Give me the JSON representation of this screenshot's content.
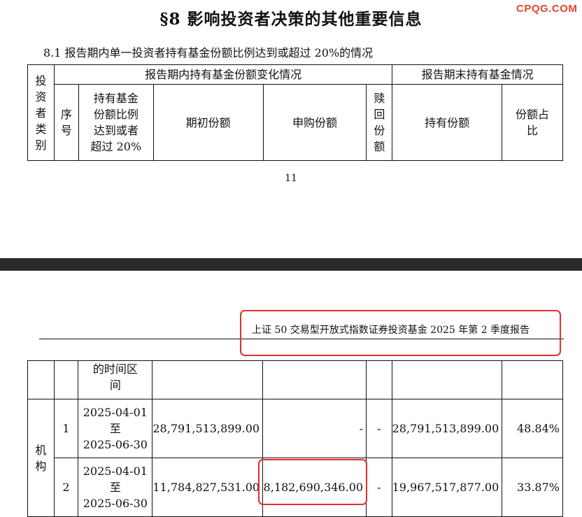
{
  "watermark": "CPQG.COM",
  "section_title": "§8  影响投资者决策的其他重要信息",
  "subsection": "8.1  报告期内单一投资者持有基金份额比例达到或超过 20%的情况",
  "table_header": {
    "investor_type": [
      "投",
      "资",
      "者",
      "类",
      "别"
    ],
    "period_change": "报告期内持有基金份额变化情况",
    "period_end": "报告期末持有基金情况",
    "seq": [
      "序",
      "号"
    ],
    "holding_range": [
      "持有基金",
      "份额比例",
      "达到或者",
      "超过 20%"
    ],
    "initial_shares": "期初份额",
    "subscribed_shares": "申购份额",
    "redeemed_shares": [
      "赎",
      "回",
      "份",
      "额"
    ],
    "held_shares": "持有份额",
    "share_ratio": [
      "份额占",
      "比"
    ]
  },
  "page_number": "11",
  "report_name": "上证 50 交易型开放式指数证券投资基金 2025 年第 2 季度报告",
  "continued_header": [
    "的时间区",
    "间"
  ],
  "investor_category": [
    "机",
    "构"
  ],
  "rows": [
    {
      "seq": "1",
      "period": [
        "2025-04-01",
        "至",
        "2025-06-30"
      ],
      "initial": "28,791,513,899.00",
      "subscribed": "-",
      "redeemed": "-",
      "held": "28,791,513,899.00",
      "ratio": "48.84%"
    },
    {
      "seq": "2",
      "period": [
        "2025-04-01",
        "至",
        "2025-06-30"
      ],
      "initial": "11,784,827,531.00",
      "subscribed": "8,182,690,346.00",
      "redeemed": "-",
      "held": "19,967,517,877.00",
      "ratio": "33.87%"
    }
  ],
  "colors": {
    "highlight": "#e0302c",
    "watermark": "#e8452c",
    "divider": "#2a2a2a"
  }
}
